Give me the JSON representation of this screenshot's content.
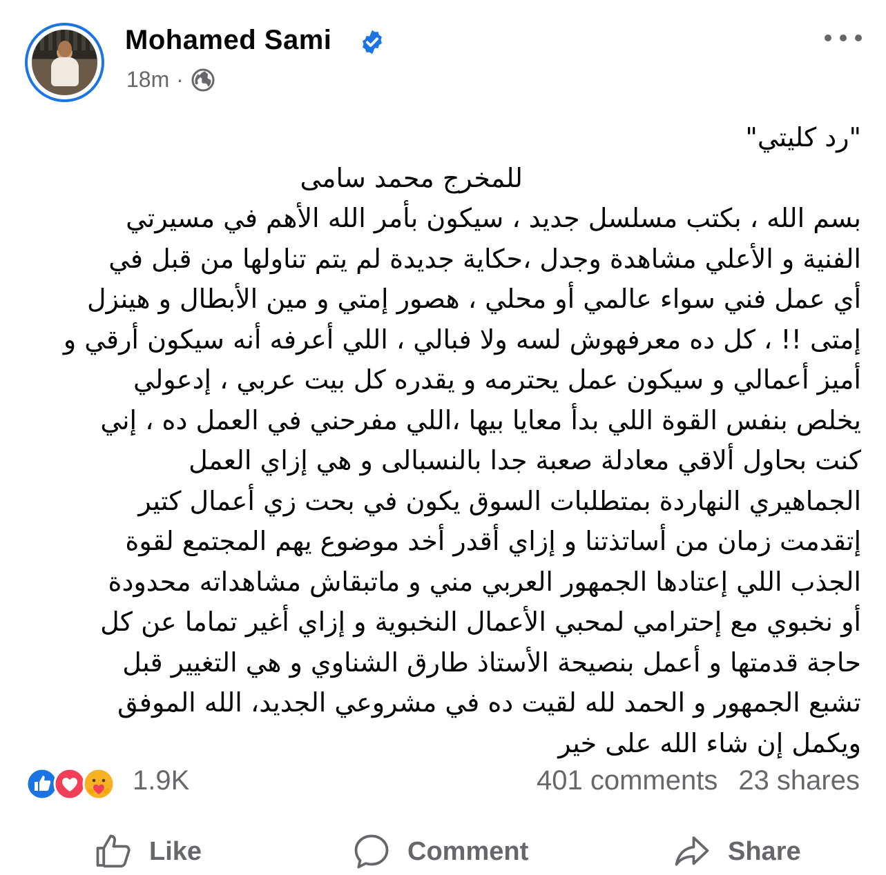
{
  "post": {
    "author": "Mohamed Sami",
    "verified": true,
    "time": "18m",
    "separator": "·",
    "audience_icon": "globe-icon",
    "menu_icon": "more-horizontal-icon",
    "text_lines": [
      "\"رد كليتي\"",
      "للمخرج محمد سامى",
      "بسم الله ، بكتب مسلسل جديد ، سيكون بأمر الله الأهم في مسيرتي",
      "الفنية و الأعلي مشاهدة وجدل ،حكاية جديدة لم يتم تناولها من قبل في",
      "أي عمل فني سواء عالمي أو محلي ، هصور إمتي و مين الأبطال و هينزل",
      "إمتى !! ، كل ده معرفهوش لسه ولا فبالي ، اللي أعرفه أنه سيكون أرقي و",
      "أميز أعمالي و سيكون عمل يحترمه و يقدره كل بيت عربي ، إدعولي",
      "يخلص بنفس القوة اللي بدأ معايا بيها ،اللي مفرحني في العمل ده ، إني",
      "كنت بحاول ألاقي معادلة صعبة جدا بالنسبالى و هي إزاي العمل",
      "الجماهيري النهاردة بمتطلبات السوق يكون في بحت زي أعمال كتير",
      "إتقدمت زمان من أساتذتنا و إزاي أقدر أخد موضوع يهم المجتمع لقوة",
      "الجذب اللي إعتادها الجمهور العربي مني و ماتبقاش مشاهداته محدودة",
      "أو نخبوي مع إحترامي لمحبي الأعمال النخبوية و إزاي أغير تماما عن كل",
      "حاجة قدمتها و أعمل بنصيحة الأستاذ طارق الشناوي و هي التغيير قبل",
      "تشبع الجمهور و الحمد لله لقيت ده في مشروعي الجديد، الله الموفق",
      "ويكمل إن شاء الله على خير"
    ]
  },
  "reactions": {
    "icons": [
      "like-reaction-icon",
      "love-reaction-icon",
      "care-reaction-icon"
    ],
    "count": "1.9K",
    "comments": "401 comments",
    "shares": "23 shares"
  },
  "actions": {
    "like": "Like",
    "comment": "Comment",
    "share": "Share"
  },
  "colors": {
    "accent": "#1b74e4",
    "secondary_text": "#65676b",
    "love": "#f33e58",
    "care": "#f7b125"
  }
}
